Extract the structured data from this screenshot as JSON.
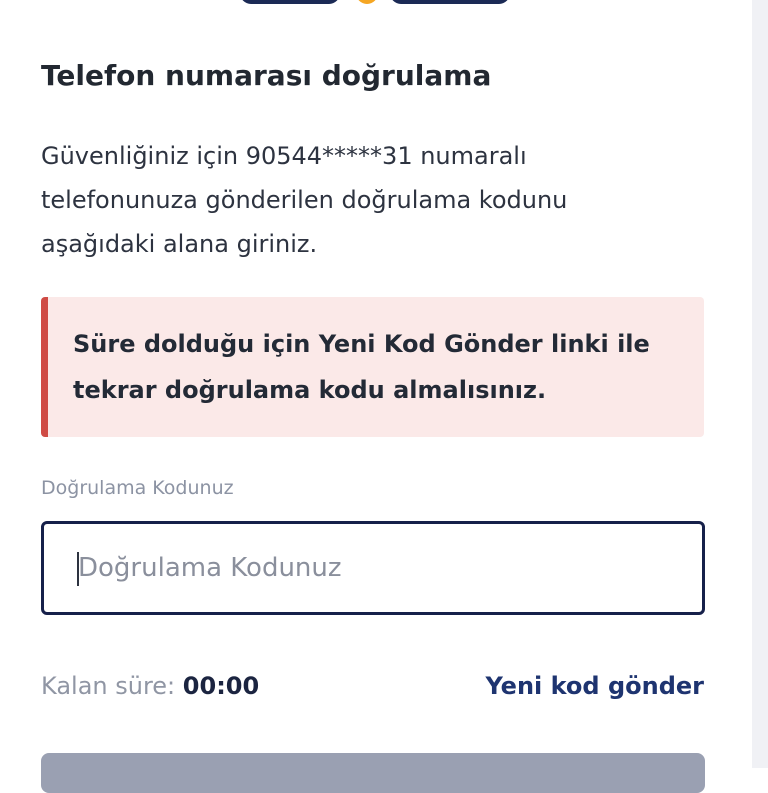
{
  "header": {
    "logo_name": "brand-logo"
  },
  "page": {
    "title": "Telefon numarası doğrulama",
    "description": "Güvenliğiniz için 90544*****31 numaralı telefonunuza gönderilen doğrulama kodunu aşağıdaki alana giriniz."
  },
  "alert": {
    "message": "Süre dolduğu için Yeni Kod Gönder linki ile tekrar doğrulama kodu almalısınız.",
    "accent_color": "#cf4b45",
    "background_color": "#fbe9e8"
  },
  "form": {
    "code_label": "Doğrulama Kodunuz",
    "code_placeholder": "Doğrulama Kodunuz",
    "code_value": "",
    "timer_label": "Kalan süre:",
    "timer_value": "00:00",
    "resend_label": "Yeni kod gönder"
  },
  "colors": {
    "primary": "#16204a",
    "link": "#1e3470",
    "disabled_button": "#9aa0b2"
  }
}
